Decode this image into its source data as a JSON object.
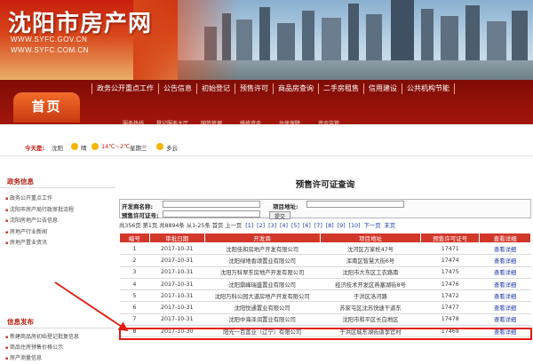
{
  "header": {
    "site_title": "沈阳市房产网",
    "url1": "WWW.SYFC.GOV.CN",
    "url2": "WWW.SYFC.COM.CN"
  },
  "nav": {
    "home": "首页",
    "main_items": [
      "政务公开重点工作",
      "公告信息",
      "初始登记",
      "预售许可",
      "商品房查询",
      "二手房租售",
      "信用建设",
      "公共机构节能"
    ],
    "sub_items": [
      "服务热线",
      "登记服务大厅",
      "网签管理",
      "维修资金",
      "住房保障",
      "资金监管"
    ]
  },
  "weather": {
    "today_label": "今天是:",
    "city": "沈阳",
    "today_weather": "晴",
    "temp": "14℃~2℃",
    "weekday": "星期三",
    "tomorrow_weather": "多云"
  },
  "sidebar": {
    "section1_title": "政务信息",
    "section1_items": [
      "政务公开重点工作",
      "沈阳市房产局行政审批流程",
      "沈阳房地产公告信息",
      "房地产行业新闻",
      "房地产置业资讯"
    ],
    "section2_title": "信息发布",
    "section2_items": [
      "新建商品房初始登记批复信息",
      "商品住房预售价格公示",
      "房产测量信息"
    ]
  },
  "main": {
    "page_title": "预售许可证查询",
    "search": {
      "developer_label": "开发商名称:",
      "project_label": "项目地址:",
      "permit_label": "预售许可证号:",
      "submit_label": "提交"
    },
    "pager": {
      "summary": "共356页 第1页 共8894条 从1-25条 首页 上一页",
      "current": "[1]",
      "pages": [
        "[2]",
        "[3]",
        "[4]",
        "[5]",
        "[6]",
        "[7]",
        "[8]",
        "[9]",
        "[10]",
        "下一页",
        "末页"
      ]
    },
    "table": {
      "headers": [
        "编号",
        "审批日期",
        "开发商",
        "项目地址",
        "预售许可证号",
        "查看详细"
      ],
      "rows": [
        [
          "1",
          "2017-10-31",
          "沈阳佳和房地产开发有限公司",
          "沈河区万家桩47号",
          "17471",
          "查看详细"
        ],
        [
          "2",
          "2017-10-31",
          "沈阳绿地香颂置业有限公司",
          "浑南区智慧大街6号",
          "17474",
          "查看详细"
        ],
        [
          "3",
          "2017-10-31",
          "沈阳万科翠东房地产开发有限公司",
          "沈阳市大东区工农路南",
          "17475",
          "查看详细"
        ],
        [
          "4",
          "2017-10-31",
          "沈阳鼎峰瑞盛置业有限公司",
          "经济技术开发区燕塞湖街8号",
          "17476",
          "查看详细"
        ],
        [
          "5",
          "2017-10-31",
          "沈阳万科公园大道房地产开发有限公司",
          "于洪区洛河路",
          "17472",
          "查看详细"
        ],
        [
          "6",
          "2017-10-31",
          "沈阳悦通置业有限公司",
          "苏家屯区沈苏快速干道东",
          "17477",
          "查看详细"
        ],
        [
          "7",
          "2017-10-31",
          "沈阳中海泽润置业有限公司",
          "沈阳市和平区长白地区",
          "17478",
          "查看详细"
        ],
        [
          "8",
          "2017-10-30",
          "阳光一百置业（辽宁）有限公司",
          "于洪区城东湖街道李官村",
          "17469",
          "查看详细"
        ]
      ]
    }
  },
  "colors": {
    "brand_red": "#d2382a",
    "highlight": "#e01b10",
    "link": "#1a3aa6"
  }
}
